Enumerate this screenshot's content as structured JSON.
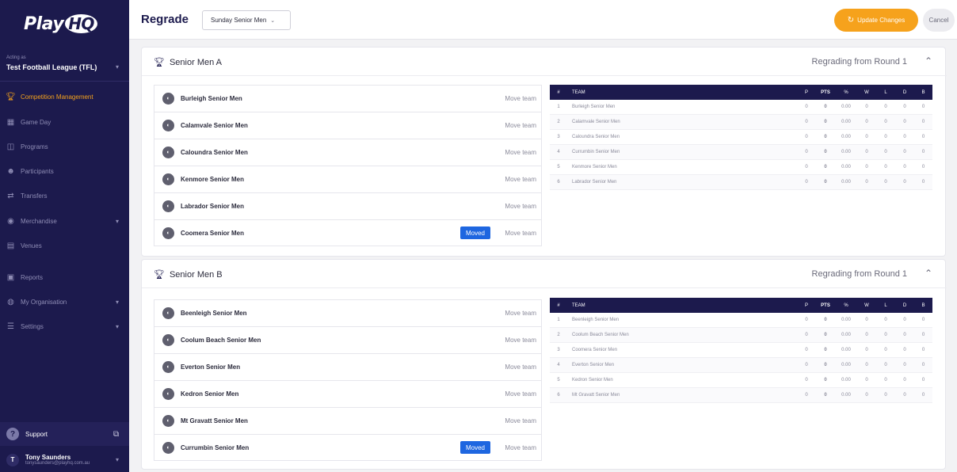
{
  "sidebar": {
    "brand": "Play",
    "brand_hq": "HQ",
    "acting_as": "Acting as",
    "organisation": "Test Football League (TFL)",
    "items": [
      {
        "label": "Competition Management",
        "icon": "trophy-icon",
        "active": true
      },
      {
        "label": "Game Day",
        "icon": "scoreboard-icon"
      },
      {
        "label": "Programs",
        "icon": "programs-icon"
      },
      {
        "label": "Participants",
        "icon": "participants-icon"
      },
      {
        "label": "Transfers",
        "icon": "transfers-icon"
      },
      {
        "label": "Merchandise",
        "icon": "merchandise-icon"
      },
      {
        "label": "Venues",
        "icon": "venues-icon"
      },
      {
        "label": "Reports",
        "icon": "reports-icon"
      },
      {
        "label": "My Organisation",
        "icon": "organisation-icon"
      },
      {
        "label": "Settings",
        "icon": "settings-icon"
      }
    ],
    "support": "Support",
    "user_name": "Tony Saunders",
    "user_email": "tonysaunders@playhq.com.au"
  },
  "topbar": {
    "title": "Regrade",
    "grade_selected": "Sunday Senior Men",
    "update_label": "Update Changes",
    "cancel_label": "Cancel"
  },
  "sections": [
    {
      "title": "Senior Men A",
      "regrading": "Regrading from Round 1",
      "move_label": "Move team",
      "moved_label": "Moved",
      "teams": [
        {
          "name": "Burleigh Senior Men",
          "moved": false
        },
        {
          "name": "Calamvale Senior Men",
          "moved": false
        },
        {
          "name": "Caloundra Senior Men",
          "moved": false
        },
        {
          "name": "Kenmore Senior Men",
          "moved": false
        },
        {
          "name": "Labrador Senior Men",
          "moved": false
        },
        {
          "name": "Coomera Senior Men",
          "moved": true
        }
      ],
      "ladder_headers": [
        "#",
        "TEAM",
        "P",
        "PTS",
        "%",
        "W",
        "L",
        "D",
        "B"
      ],
      "ladder": [
        [
          "1",
          "Burleigh Senior Men",
          "0",
          "0",
          "0.00",
          "0",
          "0",
          "0",
          "0"
        ],
        [
          "2",
          "Calamvale Senior Men",
          "0",
          "0",
          "0.00",
          "0",
          "0",
          "0",
          "0"
        ],
        [
          "3",
          "Caloundra Senior Men",
          "0",
          "0",
          "0.00",
          "0",
          "0",
          "0",
          "0"
        ],
        [
          "4",
          "Currumbin Senior Men",
          "0",
          "0",
          "0.00",
          "0",
          "0",
          "0",
          "0"
        ],
        [
          "5",
          "Kenmore Senior Men",
          "0",
          "0",
          "0.00",
          "0",
          "0",
          "0",
          "0"
        ],
        [
          "6",
          "Labrador Senior Men",
          "0",
          "0",
          "0.00",
          "0",
          "0",
          "0",
          "0"
        ]
      ]
    },
    {
      "title": "Senior Men B",
      "regrading": "Regrading from Round 1",
      "move_label": "Move team",
      "moved_label": "Moved",
      "teams": [
        {
          "name": "Beenleigh Senior Men",
          "moved": false
        },
        {
          "name": "Coolum Beach Senior Men",
          "moved": false
        },
        {
          "name": "Everton Senior Men",
          "moved": false
        },
        {
          "name": "Kedron Senior Men",
          "moved": false
        },
        {
          "name": "Mt Gravatt Senior Men",
          "moved": false
        },
        {
          "name": "Currumbin Senior Men",
          "moved": true
        }
      ],
      "ladder_headers": [
        "#",
        "TEAM",
        "P",
        "PTS",
        "%",
        "W",
        "L",
        "D",
        "B"
      ],
      "ladder": [
        [
          "1",
          "Beenleigh Senior Men",
          "0",
          "0",
          "0.00",
          "0",
          "0",
          "0",
          "0"
        ],
        [
          "2",
          "Coolum Beach Senior Men",
          "0",
          "0",
          "0.00",
          "0",
          "0",
          "0",
          "0"
        ],
        [
          "3",
          "Coomera Senior Men",
          "0",
          "0",
          "0.00",
          "0",
          "0",
          "0",
          "0"
        ],
        [
          "4",
          "Everton Senior Men",
          "0",
          "0",
          "0.00",
          "0",
          "0",
          "0",
          "0"
        ],
        [
          "5",
          "Kedron Senior Men",
          "0",
          "0",
          "0.00",
          "0",
          "0",
          "0",
          "0"
        ],
        [
          "6",
          "Mt Gravatt Senior Men",
          "0",
          "0",
          "0.00",
          "0",
          "0",
          "0",
          "0"
        ]
      ]
    }
  ],
  "colors": {
    "sidebar_bg": "#1c1a4d",
    "accent": "#f6a21c",
    "moved_badge": "#1e66e0"
  }
}
